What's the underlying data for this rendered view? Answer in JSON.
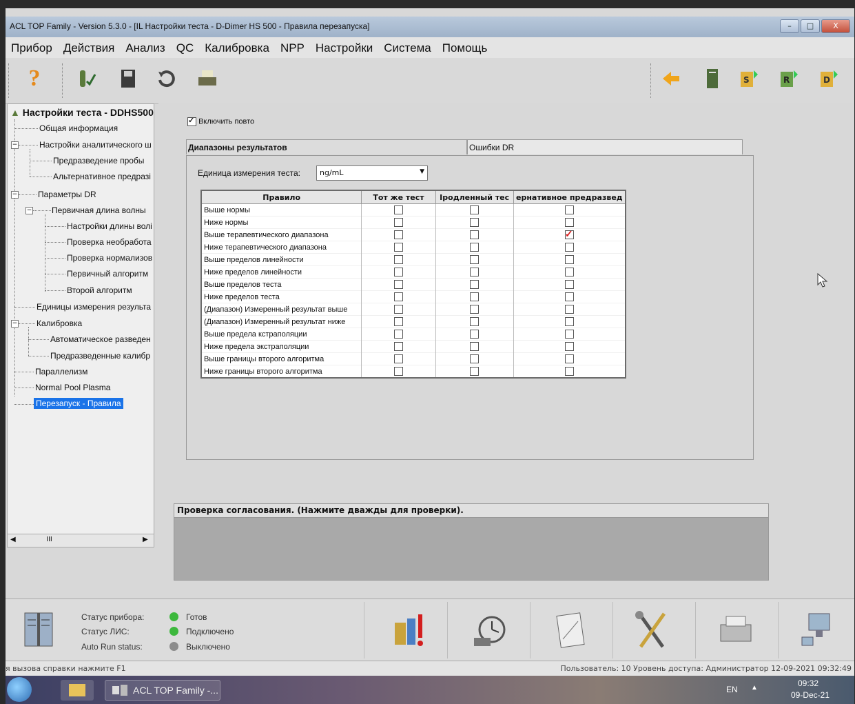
{
  "window": {
    "title": "ACL TOP Family - Version 5.3.0 - [IL Настройки теста - D-Dimer HS 500 - Правила перезапуска]",
    "minimize": "–",
    "maximize": "□",
    "close": "X"
  },
  "menu": [
    "Прибор",
    "Действия",
    "Анализ",
    "QC",
    "Калибровка",
    "NPP",
    "Настройки",
    "Система",
    "Помощь"
  ],
  "toolbar": {
    "left_icons": [
      "help-icon",
      "test-tube-check-icon",
      "save-icon",
      "refresh-icon",
      "print-icon"
    ],
    "right_icons": [
      "back-arrow-icon",
      "book-icon",
      "s-sheet-icon",
      "r-sheet-icon",
      "d-sheet-icon"
    ]
  },
  "tree": {
    "root": "Настройки теста - DDHS500",
    "items": [
      "Общая информация",
      "Настройки аналитического ш",
      "Предразведение пробы",
      "Альтернативное предразі",
      "Параметры DR",
      "Первичная длина волны",
      "Настройки длины волі",
      "Проверка необработа",
      "Проверка нормализов",
      "Первичный алгоритм",
      "Второй алгоритм",
      "Единицы измерения результа",
      "Калибровка",
      "Автоматическое разведен",
      "Предразведенные калибр",
      "Параллелизм",
      "Normal Pool Plasma",
      "Перезапуск - Правила"
    ],
    "scroll_grip": "III"
  },
  "main": {
    "enable_repeat_label": "Включить повто",
    "enable_repeat_checked": true,
    "tabs": [
      "Диапазоны результатов",
      "Ошибки DR"
    ],
    "unit_label": "Единица измерения теста:",
    "unit_value": "ng/mL",
    "columns": [
      "Правило",
      "Тот же тест",
      "Iродленный тес",
      "ернативное предразвед"
    ],
    "rows": [
      {
        "rule": "Выше нормы",
        "same": false,
        "extended": false,
        "alt": false
      },
      {
        "rule": "Ниже нормы",
        "same": false,
        "extended": false,
        "alt": false
      },
      {
        "rule": "Выше терапевтического диапазона",
        "same": false,
        "extended": false,
        "alt": true
      },
      {
        "rule": "Ниже терапевтического диапазона",
        "same": false,
        "extended": false,
        "alt": false
      },
      {
        "rule": "Выше пределов линейности",
        "same": false,
        "extended": false,
        "alt": false
      },
      {
        "rule": "Ниже пределов линейности",
        "same": false,
        "extended": false,
        "alt": false
      },
      {
        "rule": "Выше пределов теста",
        "same": false,
        "extended": false,
        "alt": false
      },
      {
        "rule": "Ниже пределов теста",
        "same": false,
        "extended": false,
        "alt": false
      },
      {
        "rule": "(Диапазон) Измеренный результат выше",
        "same": false,
        "extended": false,
        "alt": false
      },
      {
        "rule": "(Диапазон) Измеренный результат ниже",
        "same": false,
        "extended": false,
        "alt": false
      },
      {
        "rule": "Выше предела кстраполяции",
        "same": false,
        "extended": false,
        "alt": false
      },
      {
        "rule": "Ниже предела экстраполяции",
        "same": false,
        "extended": false,
        "alt": false
      },
      {
        "rule": "Выше границы второго алгоритма",
        "same": false,
        "extended": false,
        "alt": false
      },
      {
        "rule": "Ниже границы второго алгоритма",
        "same": false,
        "extended": false,
        "alt": false
      }
    ]
  },
  "consistency": {
    "header": "Проверка согласования. (Нажмите дважды для проверки)."
  },
  "status": {
    "device_label": "Статус прибора:",
    "device_value": "Готов",
    "lis_label": "Статус ЛИС:",
    "lis_value": "Подключено",
    "autorun_label": "Auto Run status:",
    "autorun_value": "Выключено",
    "colors": {
      "ok": "#3db83d",
      "off": "#8c8c8c"
    }
  },
  "bottom_icons": [
    "manual-book-icon",
    "reagent-alert-icon",
    "sample-timer-icon",
    "calibration-sheet-icon",
    "tools-icon",
    "printer-icon",
    "network-computer-icon"
  ],
  "statusbar": {
    "help_hint": "я вызова справки нажмите F1",
    "user_info": "Пользователь: 10  Уровень доступа: Администратор  12-09-2021 09:32:49"
  },
  "taskbar": {
    "task_label": "ACL TOP Family -...",
    "lang": "EN",
    "time": "09:32",
    "date": "09-Dec-21"
  }
}
